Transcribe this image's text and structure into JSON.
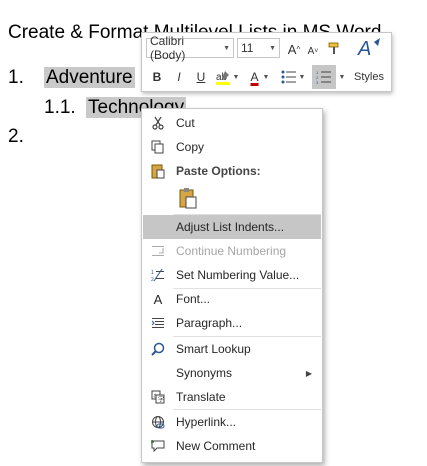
{
  "document": {
    "title": "Create & Format Multilevel Lists in MS Word",
    "items": [
      {
        "number": "1.",
        "text": "Adventure"
      },
      {
        "number": "1.1.",
        "text": "Technology"
      },
      {
        "number": "2.",
        "text": ""
      }
    ]
  },
  "mini_toolbar": {
    "font_name": "Calibri (Body)",
    "font_size": "11",
    "grow_font": "A",
    "shrink_font": "A",
    "bold": "B",
    "italic": "I",
    "underline": "U",
    "font_color": "A",
    "styles_label": "Styles",
    "icons": [
      "grow-font-icon",
      "shrink-font-icon",
      "format-painter-icon",
      "styles-icon",
      "highlight-icon",
      "font-color-icon",
      "bullets-icon",
      "numbering-icon"
    ]
  },
  "context_menu": {
    "items": [
      {
        "label": "Cut",
        "icon": "scissors-icon"
      },
      {
        "label": "Copy",
        "icon": "copy-icon"
      },
      {
        "label": "Paste Options:",
        "icon": "paste-icon"
      },
      {
        "label": "Adjust List Indents...",
        "icon": ""
      },
      {
        "label": "Continue Numbering",
        "icon": "continue-numbering-icon"
      },
      {
        "label": "Set Numbering Value...",
        "icon": "set-numbering-icon"
      },
      {
        "label": "Font...",
        "icon": "font-icon"
      },
      {
        "label": "Paragraph...",
        "icon": "paragraph-icon"
      },
      {
        "label": "Smart Lookup",
        "icon": "smart-lookup-icon"
      },
      {
        "label": "Synonyms",
        "icon": ""
      },
      {
        "label": "Translate",
        "icon": "translate-icon"
      },
      {
        "label": "Hyperlink...",
        "icon": "hyperlink-icon"
      },
      {
        "label": "New Comment",
        "icon": "new-comment-icon"
      }
    ],
    "font_icon_glyph": "A",
    "highlight_color": "#c6c6c6",
    "disabled_color": "#a6a6a6"
  }
}
